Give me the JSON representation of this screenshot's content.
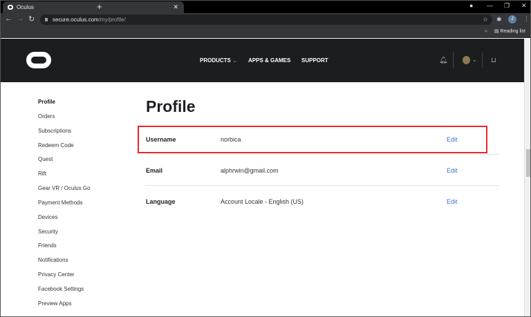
{
  "browser": {
    "tab_title": "Oculus",
    "url_host": "secure.oculus.com",
    "url_path": "/my/profile/",
    "reading_list": "Reading list",
    "profile_initial": "J"
  },
  "header": {
    "nav": [
      "PRODUCTS",
      "APPS & GAMES",
      "SUPPORT"
    ]
  },
  "sidebar": {
    "items": [
      "Profile",
      "Orders",
      "Subscriptions",
      "Redeem Code",
      "Quest",
      "Rift",
      "Gear VR / Oculus Go",
      "Payment Methods",
      "Devices",
      "Security",
      "Friends",
      "Notifications",
      "Privacy Center",
      "Facebook Settings",
      "Preview Apps"
    ]
  },
  "main": {
    "title": "Profile",
    "rows": [
      {
        "label": "Username",
        "value": "norbica",
        "action": "Edit"
      },
      {
        "label": "Email",
        "value": "alphrwin@gmail.com",
        "action": "Edit"
      },
      {
        "label": "Language",
        "value": "Account Locale - English (US)",
        "action": "Edit"
      }
    ],
    "highlight_color": "#e8262b",
    "link_color": "#3b6fd4"
  }
}
